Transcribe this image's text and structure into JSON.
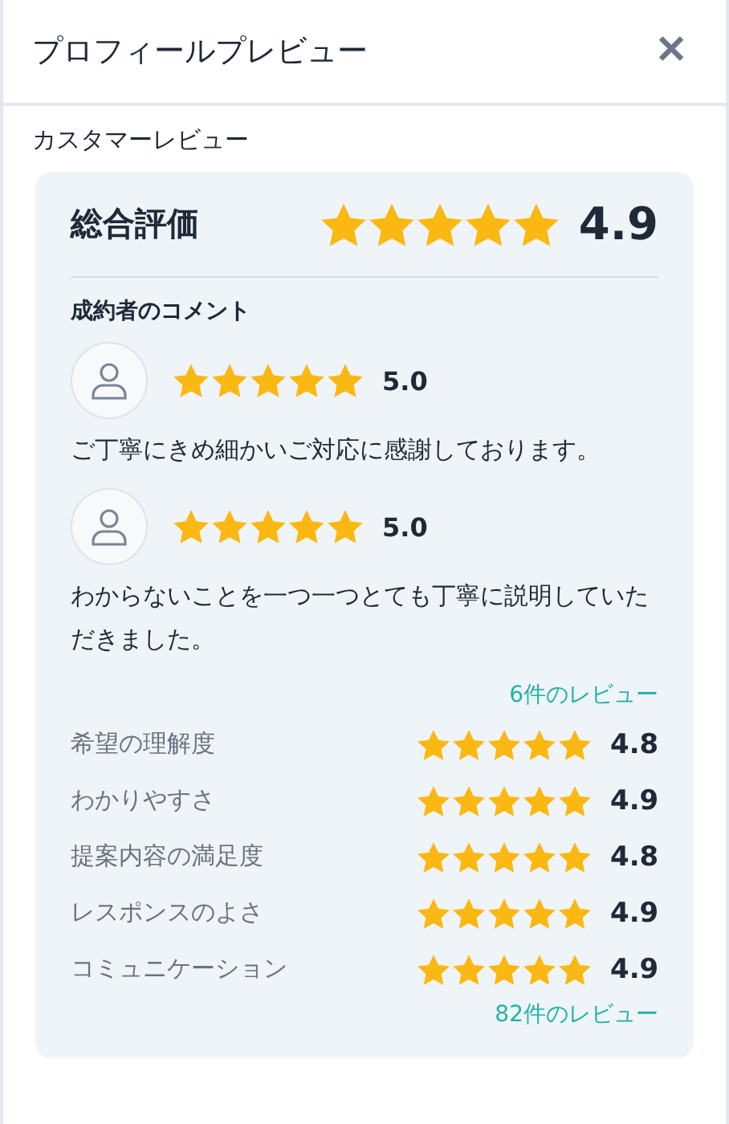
{
  "header": {
    "title": "プロフィールプレビュー",
    "close": "✕"
  },
  "section_title": "カスタマーレビュー",
  "overall": {
    "label": "総合評価",
    "stars": 5,
    "score": "4.9"
  },
  "comments": {
    "title": "成約者のコメント",
    "items": [
      {
        "stars": 5,
        "score": "5.0",
        "text": "ご丁寧にきめ細かいご対応に感謝しております。"
      },
      {
        "stars": 5,
        "score": "5.0",
        "text": "わからないことを一つ一つとても丁寧に説明していただきました。"
      }
    ],
    "link": "6件のレビュー"
  },
  "categories": [
    {
      "label": "希望の理解度",
      "stars": 5,
      "score": "4.8"
    },
    {
      "label": "わかりやすさ",
      "stars": 5,
      "score": "4.9"
    },
    {
      "label": "提案内容の満足度",
      "stars": 5,
      "score": "4.8"
    },
    {
      "label": "レスポンスのよさ",
      "stars": 5,
      "score": "4.9"
    },
    {
      "label": "コミュニケーション",
      "stars": 5,
      "score": "4.9"
    }
  ],
  "categories_link": "82件のレビュー"
}
